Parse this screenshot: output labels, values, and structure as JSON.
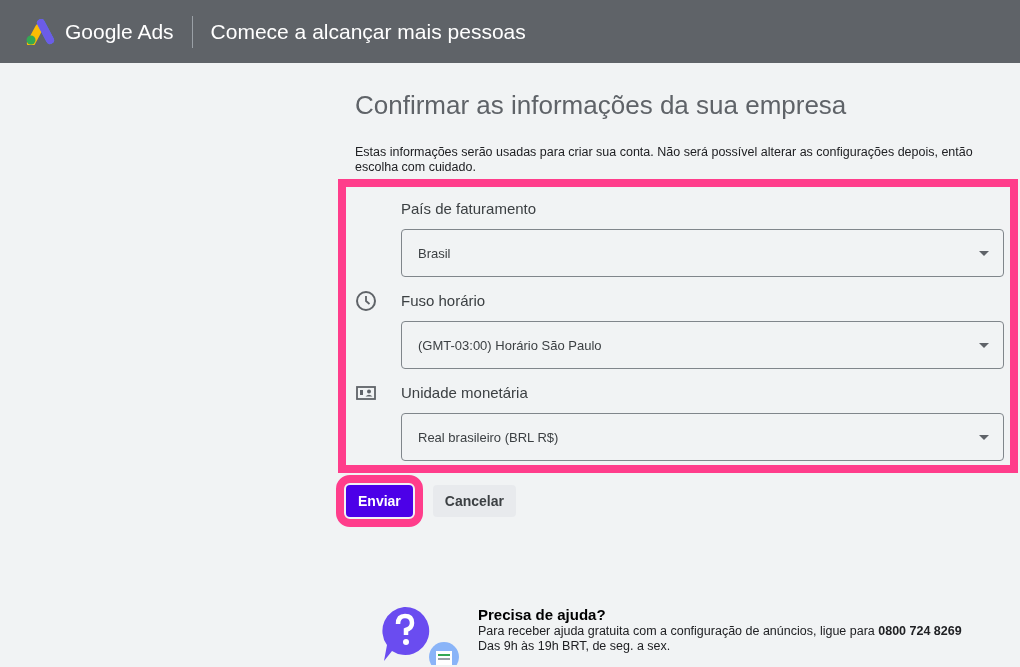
{
  "header": {
    "product": "Google Ads",
    "title": "Comece a alcançar mais pessoas"
  },
  "page_title": "Confirmar as informações da sua empresa",
  "description": "Estas informações serão usadas para criar sua conta. Não será possível alterar as configurações depois, então escolha com cuidado.",
  "form": {
    "highlighted": true,
    "fields": [
      {
        "label": "País de faturamento",
        "value": "Brasil"
      },
      {
        "label": "Fuso horário",
        "value": "(GMT-03:00) Horário São Paulo"
      },
      {
        "label": "Unidade monetária",
        "value": "Real brasileiro (BRL R$)"
      }
    ]
  },
  "buttons": [
    {
      "label": "Enviar",
      "kind": "primary",
      "highlighted": true
    },
    {
      "label": "Cancelar",
      "kind": "secondary",
      "highlighted": false
    }
  ],
  "help": {
    "title": "Precisa de ajuda?",
    "text": "Para receber ajuda gratuita com a configuração de anúncios, ligue para **0800 724 8269**",
    "hours": "Das 9h às 19h BRT, de seg. a sex."
  }
}
